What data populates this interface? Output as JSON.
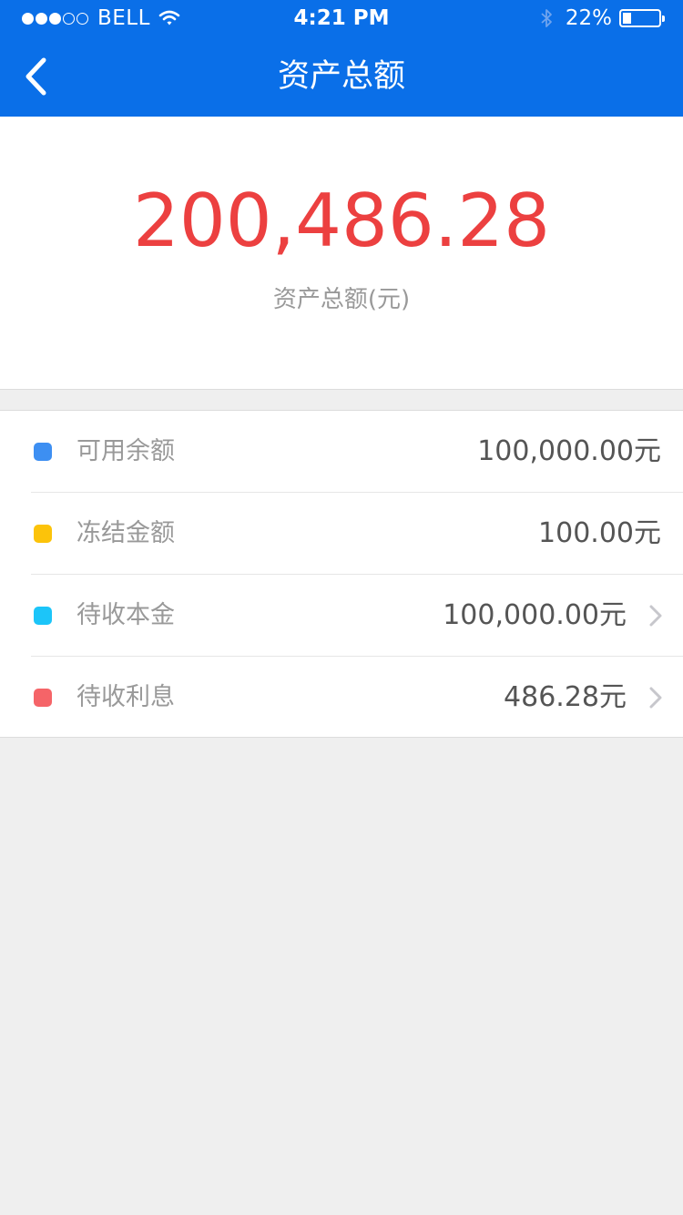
{
  "status_bar": {
    "carrier": "BELL",
    "signal_filled": 3,
    "signal_total": 5,
    "time": "4:21 PM",
    "battery_percent": "22%",
    "battery_level": 0.22
  },
  "nav": {
    "title": "资产总额",
    "back_icon": "chevron-left-icon"
  },
  "summary": {
    "total_amount": "200,486.28",
    "total_label": "资产总额(元)",
    "amount_color": "#ec4040"
  },
  "items": [
    {
      "label": "可用余额",
      "value": "100,000.00元",
      "color": "#3d8ff2",
      "has_arrow": false
    },
    {
      "label": "冻结金额",
      "value": "100.00元",
      "color": "#fcc30a",
      "has_arrow": false
    },
    {
      "label": "待收本金",
      "value": "100,000.00元",
      "color": "#1cc5f9",
      "has_arrow": true
    },
    {
      "label": "待收利息",
      "value": "486.28元",
      "color": "#f56468",
      "has_arrow": true
    }
  ],
  "theme": {
    "header_color": "#0a6fe8"
  }
}
